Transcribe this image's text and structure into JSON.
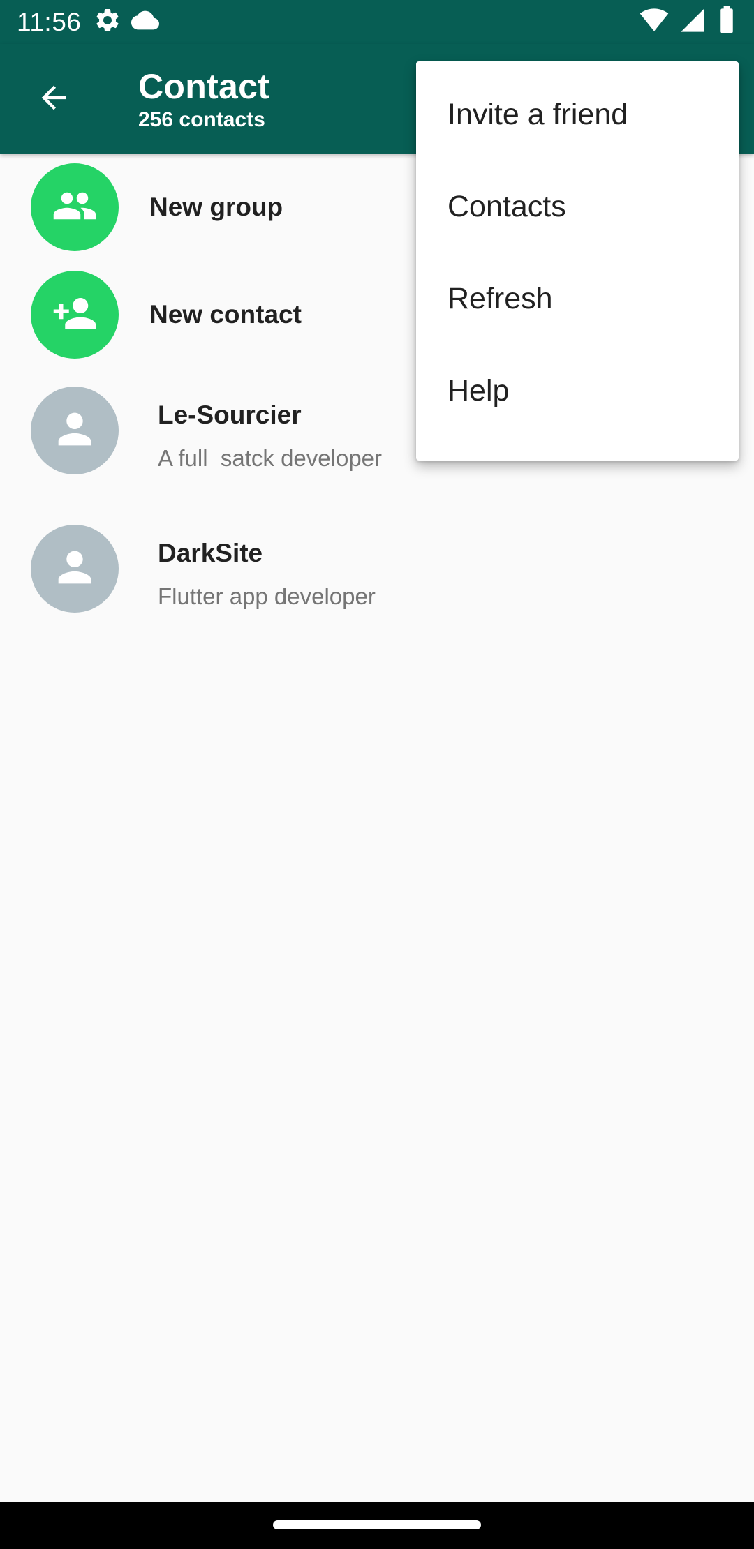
{
  "status_bar": {
    "time": "11:56",
    "left_icons": [
      "settings-icon",
      "cloud-icon"
    ],
    "right_icons": [
      "wifi-icon",
      "signal-icon",
      "battery-icon"
    ]
  },
  "app_bar": {
    "title": "Contact",
    "subtitle": "256 contacts",
    "color": "#075e54"
  },
  "list": {
    "actions": [
      {
        "label": "New group",
        "icon": "group-icon"
      },
      {
        "label": "New contact",
        "icon": "person-add-icon"
      }
    ],
    "contacts": [
      {
        "name": "Le-Sourcier",
        "status": "A full  satck developer"
      },
      {
        "name": "DarkSite",
        "status": "Flutter app developer"
      }
    ]
  },
  "menu": {
    "items": [
      "Invite a friend",
      "Contacts",
      "Refresh",
      "Help"
    ]
  },
  "colors": {
    "accent": "#25d366",
    "avatar_placeholder": "#b0bec5",
    "background": "#fafafa"
  }
}
